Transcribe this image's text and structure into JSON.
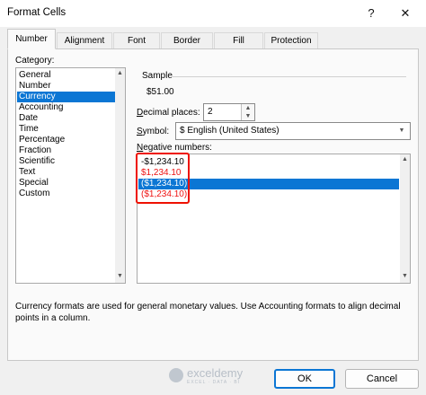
{
  "window": {
    "title": "Format Cells",
    "help_glyph": "?",
    "close_glyph": "✕"
  },
  "tabs": [
    {
      "label": "Number",
      "active": true
    },
    {
      "label": "Alignment",
      "active": false
    },
    {
      "label": "Font",
      "active": false
    },
    {
      "label": "Border",
      "active": false
    },
    {
      "label": "Fill",
      "active": false
    },
    {
      "label": "Protection",
      "active": false
    }
  ],
  "category": {
    "label": "Category:",
    "items": [
      "General",
      "Number",
      "Currency",
      "Accounting",
      "Date",
      "Time",
      "Percentage",
      "Fraction",
      "Scientific",
      "Text",
      "Special",
      "Custom"
    ],
    "selected": "Currency"
  },
  "sample": {
    "label": "Sample",
    "value": "$51.00"
  },
  "decimal_places": {
    "label": "Decimal places:",
    "value": "2"
  },
  "symbol": {
    "label": "Symbol:",
    "value": "$ English (United States)"
  },
  "negative_numbers": {
    "label": "Negative numbers:",
    "items": [
      {
        "text": "-$1,234.10",
        "color": "#000000",
        "selected": false
      },
      {
        "text": "$1,234.10",
        "color": "#e11111",
        "selected": false
      },
      {
        "text": "($1,234.10)",
        "color": "#000000",
        "selected": true
      },
      {
        "text": "($1,234.10)",
        "color": "#e11111",
        "selected": false
      }
    ]
  },
  "description": "Currency formats are used for general monetary values.  Use Accounting formats to align decimal points in a column.",
  "watermark": {
    "name": "exceldemy",
    "tagline": "EXCEL · DATA · BI"
  },
  "buttons": {
    "ok": "OK",
    "cancel": "Cancel"
  },
  "colors": {
    "selection": "#0b76d4",
    "negative_red": "#e11111",
    "highlight_outline": "#e10000"
  }
}
